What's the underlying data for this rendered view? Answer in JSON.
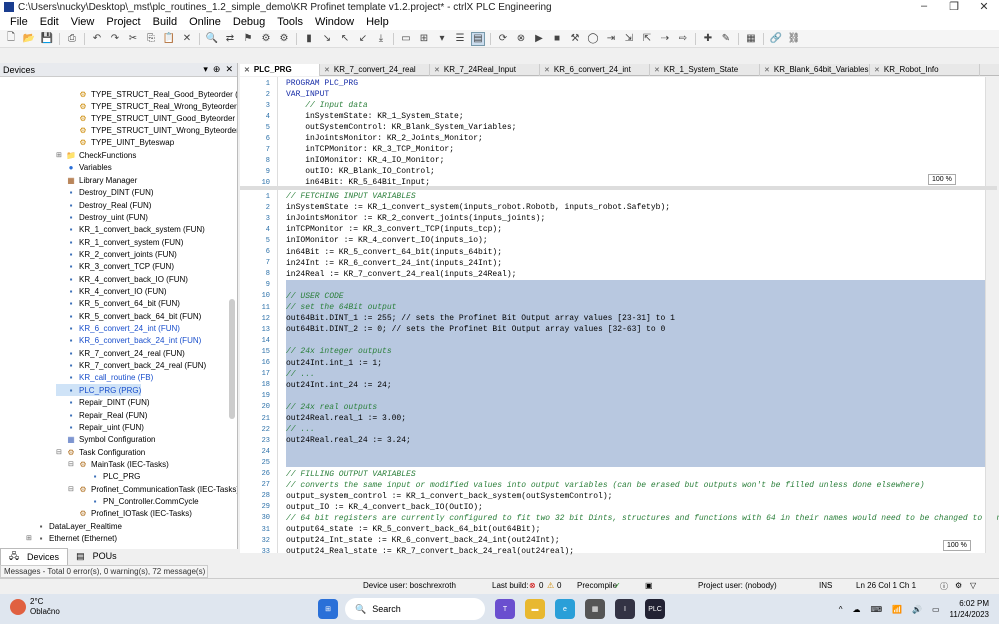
{
  "window": {
    "title": "C:\\Users\\nucky\\Desktop\\_mst\\plc_routines_1.2_simple_demo\\KR Profinet template v1.2.project* - ctrlX PLC Engineering",
    "controls": [
      "–",
      "❐",
      "✕"
    ]
  },
  "menu": [
    "File",
    "Edit",
    "View",
    "Project",
    "Build",
    "Online",
    "Debug",
    "Tools",
    "Window",
    "Help"
  ],
  "devices_panel": {
    "title": "Devices",
    "controls": [
      "▾",
      "⊕",
      "✕"
    ],
    "items": [
      {
        "label": "TYPE_STRUCT_Real_Good_Byteorder (STR"
      },
      {
        "label": "TYPE_STRUCT_Real_Wrong_Byteorder (STRU"
      },
      {
        "label": "TYPE_STRUCT_UINT_Good_Byteorder (STRUC"
      },
      {
        "label": "TYPE_STRUCT_UINT_Wrong_Byteorder (STRU"
      },
      {
        "label": "TYPE_UINT_Byteswap"
      },
      {
        "label": "CheckFunctions"
      },
      {
        "label": "Variables"
      },
      {
        "label": "Library Manager"
      },
      {
        "label": "Destroy_DINT (FUN)"
      },
      {
        "label": "Destroy_Real (FUN)"
      },
      {
        "label": "Destroy_uint (FUN)"
      },
      {
        "label": "KR_1_convert_back_system (FUN)"
      },
      {
        "label": "KR_1_convert_system (FUN)"
      },
      {
        "label": "KR_2_convert_joints (FUN)"
      },
      {
        "label": "KR_3_convert_TCP (FUN)"
      },
      {
        "label": "KR_4_convert_back_IO (FUN)"
      },
      {
        "label": "KR_4_convert_IO (FUN)"
      },
      {
        "label": "KR_5_convert_64_bit (FUN)"
      },
      {
        "label": "KR_5_convert_back_64_bit (FUN)"
      },
      {
        "label": "KR_6_convert_24_int (FUN)"
      },
      {
        "label": "KR_6_convert_back_24_int (FUN)"
      },
      {
        "label": "KR_7_convert_24_real (FUN)"
      },
      {
        "label": "KR_7_convert_back_24_real (FUN)"
      },
      {
        "label": "KR_call_routine (FB)"
      },
      {
        "label": "PLC_PRG (PRG)"
      },
      {
        "label": "Repair_DINT (FUN)"
      },
      {
        "label": "Repair_Real (FUN)"
      },
      {
        "label": "Repair_uint (FUN)"
      },
      {
        "label": "Symbol Configuration"
      },
      {
        "label": "Task Configuration"
      },
      {
        "label": "MainTask (IEC-Tasks)"
      },
      {
        "label": "PLC_PRG"
      },
      {
        "label": "Profinet_CommunicationTask (IEC-Tasks)"
      },
      {
        "label": "PN_Controller.CommCycle"
      },
      {
        "label": "Profinet_IOTask (IEC-Tasks)"
      },
      {
        "label": "DataLayer_Realtime"
      },
      {
        "label": "Ethernet (Ethernet)"
      }
    ]
  },
  "left_tabs": [
    "Devices",
    "POUs"
  ],
  "messages": "Messages - Total 0 error(s), 0 warning(s), 72 message(s)",
  "doc_tabs": [
    "PLC_PRG",
    "KR_7_convert_24_real",
    "KR_7_24Real_Input",
    "KR_6_convert_24_int",
    "KR_1_System_State",
    "KR_Blank_64bit_Variables",
    "KR_Robot_Info"
  ],
  "decl_lines": [
    {
      "n": "1",
      "t": "PROGRAM PLC_PRG",
      "c": "kw"
    },
    {
      "n": "2",
      "t": "VAR_INPUT",
      "c": "kw"
    },
    {
      "n": "3",
      "t": "    // Input data",
      "c": "cmt"
    },
    {
      "n": "4",
      "t": "    inSystemState: KR_1_System_State;",
      "c": ""
    },
    {
      "n": "5",
      "t": "    outSystemControl: KR_Blank_System_Variables;",
      "c": ""
    },
    {
      "n": "6",
      "t": "    inJointsMonitor: KR_2_Joints_Monitor;",
      "c": ""
    },
    {
      "n": "7",
      "t": "    inTCPMonitor: KR_3_TCP_Monitor;",
      "c": ""
    },
    {
      "n": "8",
      "t": "    inIOMonitor: KR_4_IO_Monitor;",
      "c": ""
    },
    {
      "n": "9",
      "t": "    outIO: KR_Blank_IO_Control;",
      "c": ""
    },
    {
      "n": "10",
      "t": "    in64Bit: KR_5_64Bit_Input;",
      "c": ""
    }
  ],
  "body_lines": [
    {
      "n": "1",
      "t": "// FETCHING INPUT VARIABLES",
      "c": "cmt"
    },
    {
      "n": "2",
      "t": "inSystemState := KR_1_convert_system(inputs_robot.Robotb, inputs_robot.Safetyb);",
      "c": ""
    },
    {
      "n": "3",
      "t": "inJointsMonitor := KR_2_convert_joints(inputs_joints);",
      "c": ""
    },
    {
      "n": "4",
      "t": "inTCPMonitor := KR_3_convert_TCP(inputs_tcp);",
      "c": ""
    },
    {
      "n": "5",
      "t": "inIOMonitor := KR_4_convert_IO(inputs_io);",
      "c": ""
    },
    {
      "n": "6",
      "t": "in64Bit := KR_5_convert_64_bit(inputs_64bit);",
      "c": ""
    },
    {
      "n": "7",
      "t": "in24Int := KR_6_convert_24_int(inputs_24Int);",
      "c": ""
    },
    {
      "n": "8",
      "t": "in24Real := KR_7_convert_24_real(inputs_24Real);",
      "c": ""
    },
    {
      "n": "9",
      "t": "",
      "c": ""
    },
    {
      "n": "10",
      "t": "// USER CODE",
      "c": "cmt"
    },
    {
      "n": "11",
      "t": "// set the 64Bit output",
      "c": "cmt"
    },
    {
      "n": "12",
      "t": "out64Bit.DINT_1 := 255; // sets the Profinet Bit Output array values [23-31] to 1",
      "c": ""
    },
    {
      "n": "13",
      "t": "out64Bit.DINT_2 := 0; // sets the Profinet Bit Output array values [32-63] to 0",
      "c": ""
    },
    {
      "n": "14",
      "t": "",
      "c": ""
    },
    {
      "n": "15",
      "t": "// 24x integer outputs",
      "c": "cmt"
    },
    {
      "n": "16",
      "t": "out24Int.int_1 := 1;",
      "c": ""
    },
    {
      "n": "17",
      "t": "// ...",
      "c": "cmt"
    },
    {
      "n": "18",
      "t": "out24Int.int_24 := 24;",
      "c": ""
    },
    {
      "n": "19",
      "t": "",
      "c": ""
    },
    {
      "n": "20",
      "t": "// 24x real outputs",
      "c": "cmt"
    },
    {
      "n": "21",
      "t": "out24Real.real_1 := 3.00;",
      "c": ""
    },
    {
      "n": "22",
      "t": "// ...",
      "c": "cmt"
    },
    {
      "n": "23",
      "t": "out24Real.real_24 := 3.24;",
      "c": ""
    },
    {
      "n": "24",
      "t": "",
      "c": ""
    },
    {
      "n": "25",
      "t": "",
      "c": ""
    },
    {
      "n": "26",
      "t": "// FILLING OUTPUT VARIABLES",
      "c": "cmt"
    },
    {
      "n": "27",
      "t": "// converts the same input or modified values into output variables (can be erased but outputs won't be filled unless done elsewhere)",
      "c": "cmt"
    },
    {
      "n": "28",
      "t": "output_system_control := KR_1_convert_back_system(outSystemControl);",
      "c": ""
    },
    {
      "n": "29",
      "t": "output_IO := KR_4_convert_back_IO(OutIO);",
      "c": ""
    },
    {
      "n": "30",
      "t": "// 64 bit registers are currently configured to fit two 32 bit Dints, structures and functions with 64 in their names would need to be changed to configu",
      "c": "cmt"
    },
    {
      "n": "31",
      "t": "output64_state := KR_5_convert_back_64_bit(out64Bit);",
      "c": ""
    },
    {
      "n": "32",
      "t": "output24_Int_state := KR_6_convert_back_24_int(out24Int);",
      "c": ""
    },
    {
      "n": "33",
      "t": "output24_Real_state := KR_7_convert_back_24_real(out24real);",
      "c": ""
    }
  ],
  "zoom_top": "100 %",
  "zoom_bottom": "100 %",
  "status": {
    "device_user": "Device user: boschrexroth",
    "last_build": "Last build:",
    "errors": "0",
    "warnings": "0",
    "precompile": "Precompile",
    "project_user": "Project user: (nobody)",
    "ins": "INS",
    "position": "Ln 26  Col 1  Ch 1"
  },
  "taskbar": {
    "temp": "2°C",
    "weather": "Oblačno",
    "search": "Search",
    "time": "6:02 PM",
    "date": "11/24/2023"
  },
  "colors": {
    "selection": "#b8c8e0",
    "comment": "#2a7f3a",
    "line_number": "#2a6fa8"
  }
}
